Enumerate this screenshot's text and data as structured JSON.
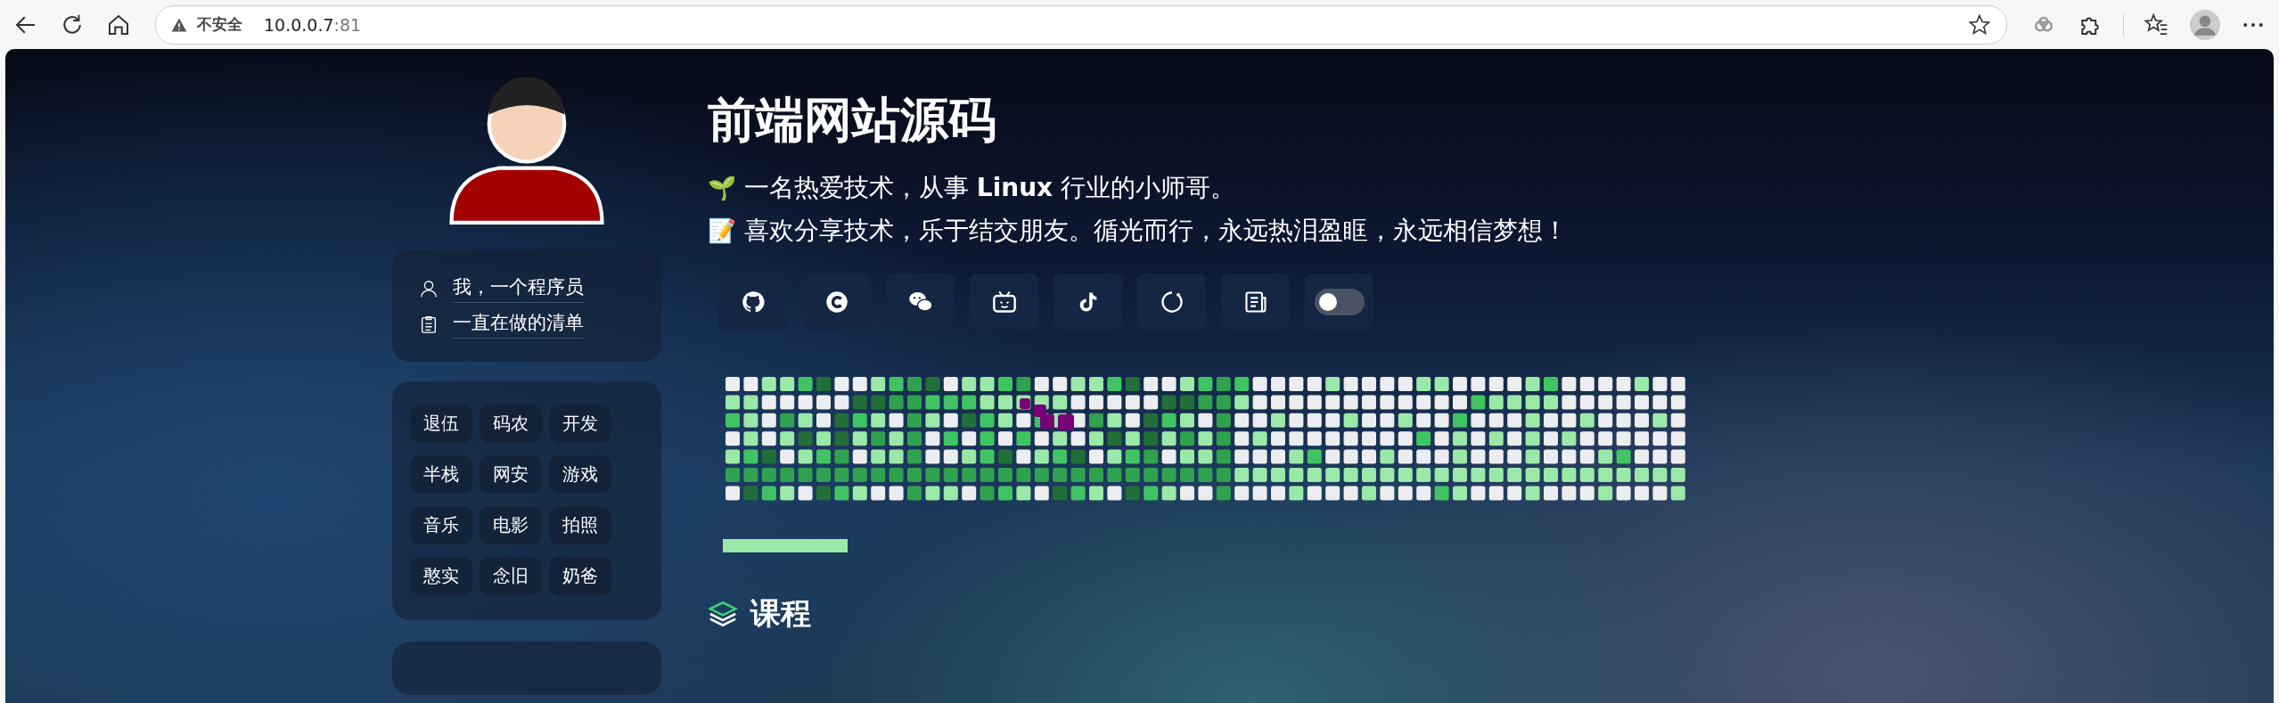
{
  "browser": {
    "security_label": "不安全",
    "url_host": "10.0.0.7",
    "url_port": ":81"
  },
  "profile": {
    "menu": [
      {
        "kind": "person",
        "label": "我，一个程序员"
      },
      {
        "kind": "clipboard",
        "label": "一直在做的清单"
      }
    ],
    "tags": [
      "退伍",
      "码农",
      "开发",
      "半栈",
      "网安",
      "游戏",
      "音乐",
      "电影",
      "拍照",
      "憨实",
      "念旧",
      "奶爸"
    ]
  },
  "title": "前端网站源码",
  "intro": [
    {
      "emoji": "🌱",
      "text": "一名热爱技术，从事 **Linux** 行业的小师哥。"
    },
    {
      "emoji": "📝",
      "text": "喜欢分享技术，乐于结交朋友。循光而行，永远热泪盈眶，永远相信梦想！"
    }
  ],
  "links": [
    {
      "kind": "github"
    },
    {
      "kind": "csdn"
    },
    {
      "kind": "wechat"
    },
    {
      "kind": "bilibili"
    },
    {
      "kind": "tiktok"
    },
    {
      "kind": "circle"
    },
    {
      "kind": "notes"
    },
    {
      "kind": "switch",
      "on": false
    }
  ],
  "section": {
    "title": "课程"
  }
}
